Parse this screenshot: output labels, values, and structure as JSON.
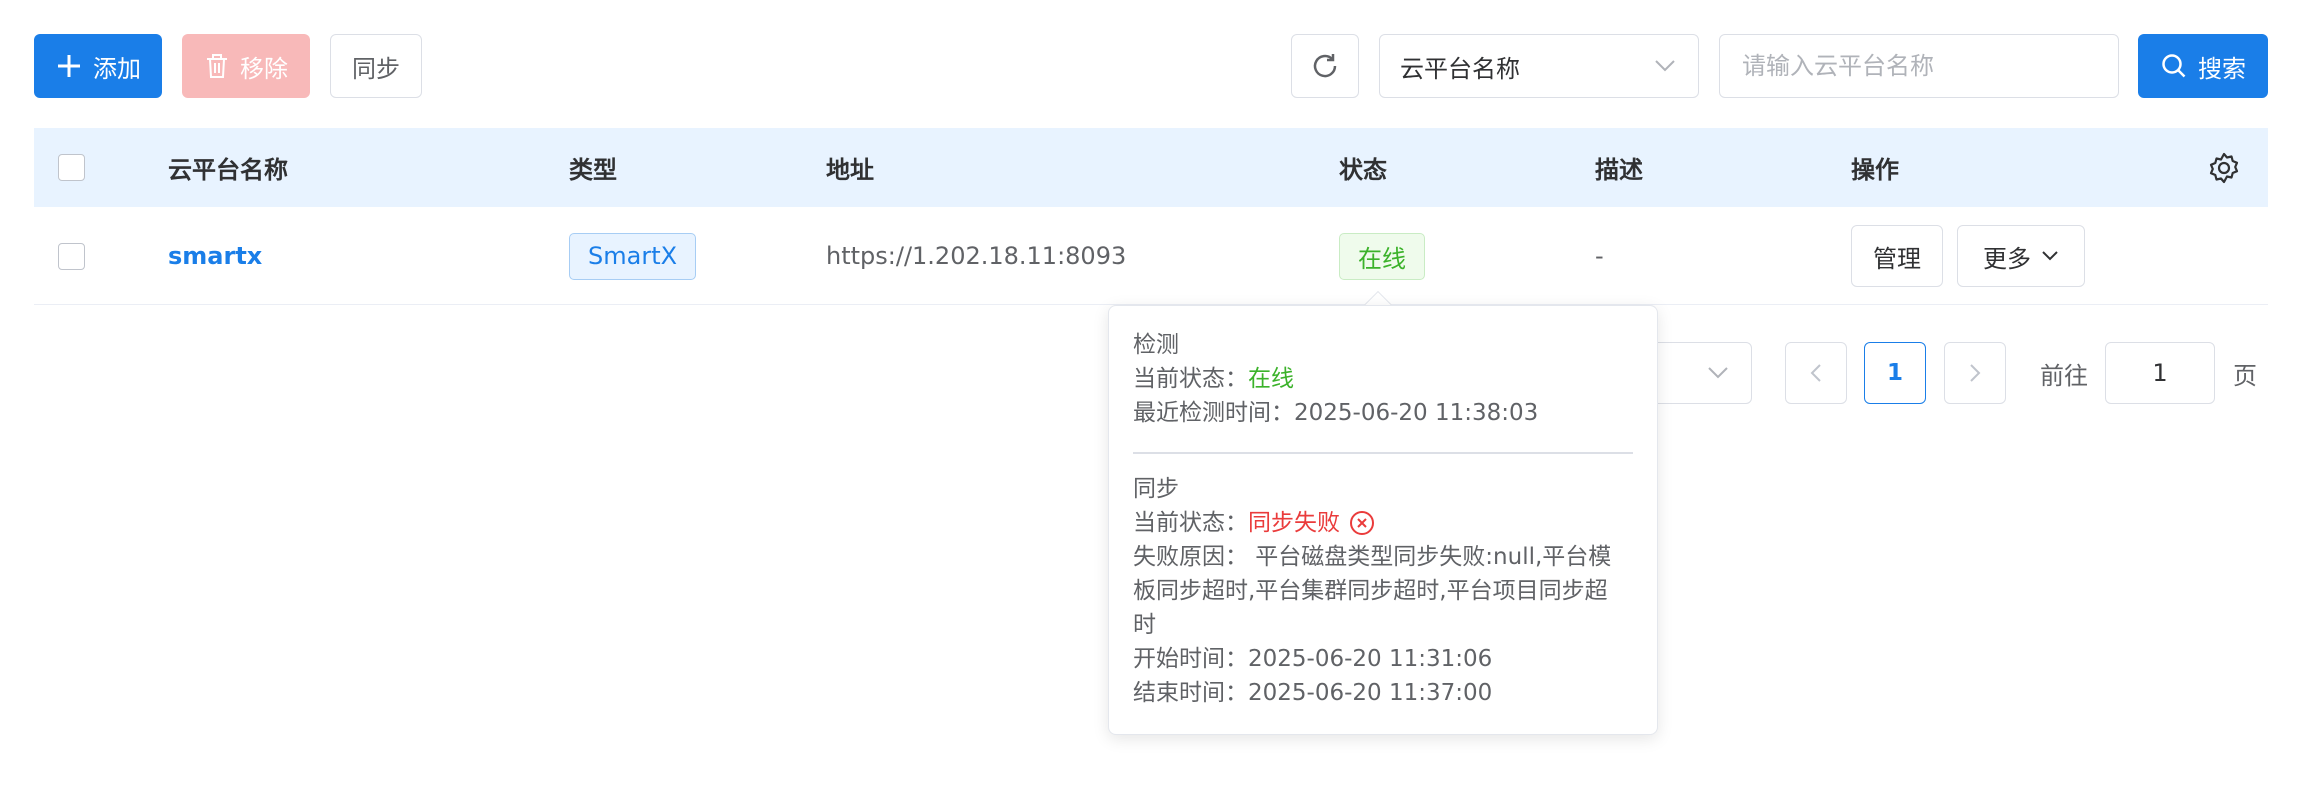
{
  "toolbar": {
    "add_label": "添加",
    "remove_label": "移除",
    "sync_label": "同步",
    "filter_select_value": "云平台名称",
    "search_placeholder": "请输入云平台名称",
    "search_label": "搜索"
  },
  "table": {
    "headers": [
      "云平台名称",
      "类型",
      "地址",
      "状态",
      "描述",
      "操作"
    ],
    "rows": [
      {
        "name": "smartx",
        "type": "SmartX",
        "address": "https://1.202.18.11:8093",
        "status": "在线",
        "description": "-",
        "actions": {
          "manage": "管理",
          "more": "更多"
        }
      }
    ]
  },
  "pagination": {
    "current_page": "1",
    "goto_label": "前往",
    "goto_value": "1",
    "page_suffix": "页"
  },
  "popover": {
    "detect_title": "检测",
    "detect_status_label": "当前状态：",
    "detect_status_value": "在线",
    "detect_time_label": "最近检测时间：",
    "detect_time_value": "2025-06-20 11:38:03",
    "sync_title": "同步",
    "sync_status_label": "当前状态：",
    "sync_status_value": "同步失败",
    "fail_reason_line1": "失败原因：  平台磁盘类型同步失败:null,平台模",
    "fail_reason_line2": "板同步超时,平台集群同步超时,平台项目同步超",
    "fail_reason_line3": "时",
    "start_time_label": "开始时间：",
    "start_time_value": "2025-06-20 11:31:06",
    "end_time_label": "结束时间：",
    "end_time_value": "2025-06-20 11:37:00"
  },
  "colors": {
    "primary": "#1a7ee8",
    "danger_disabled": "#f8b9b9",
    "success": "#3bb22a",
    "error": "#ea3b3b",
    "header_bg": "#e8f3ff"
  }
}
